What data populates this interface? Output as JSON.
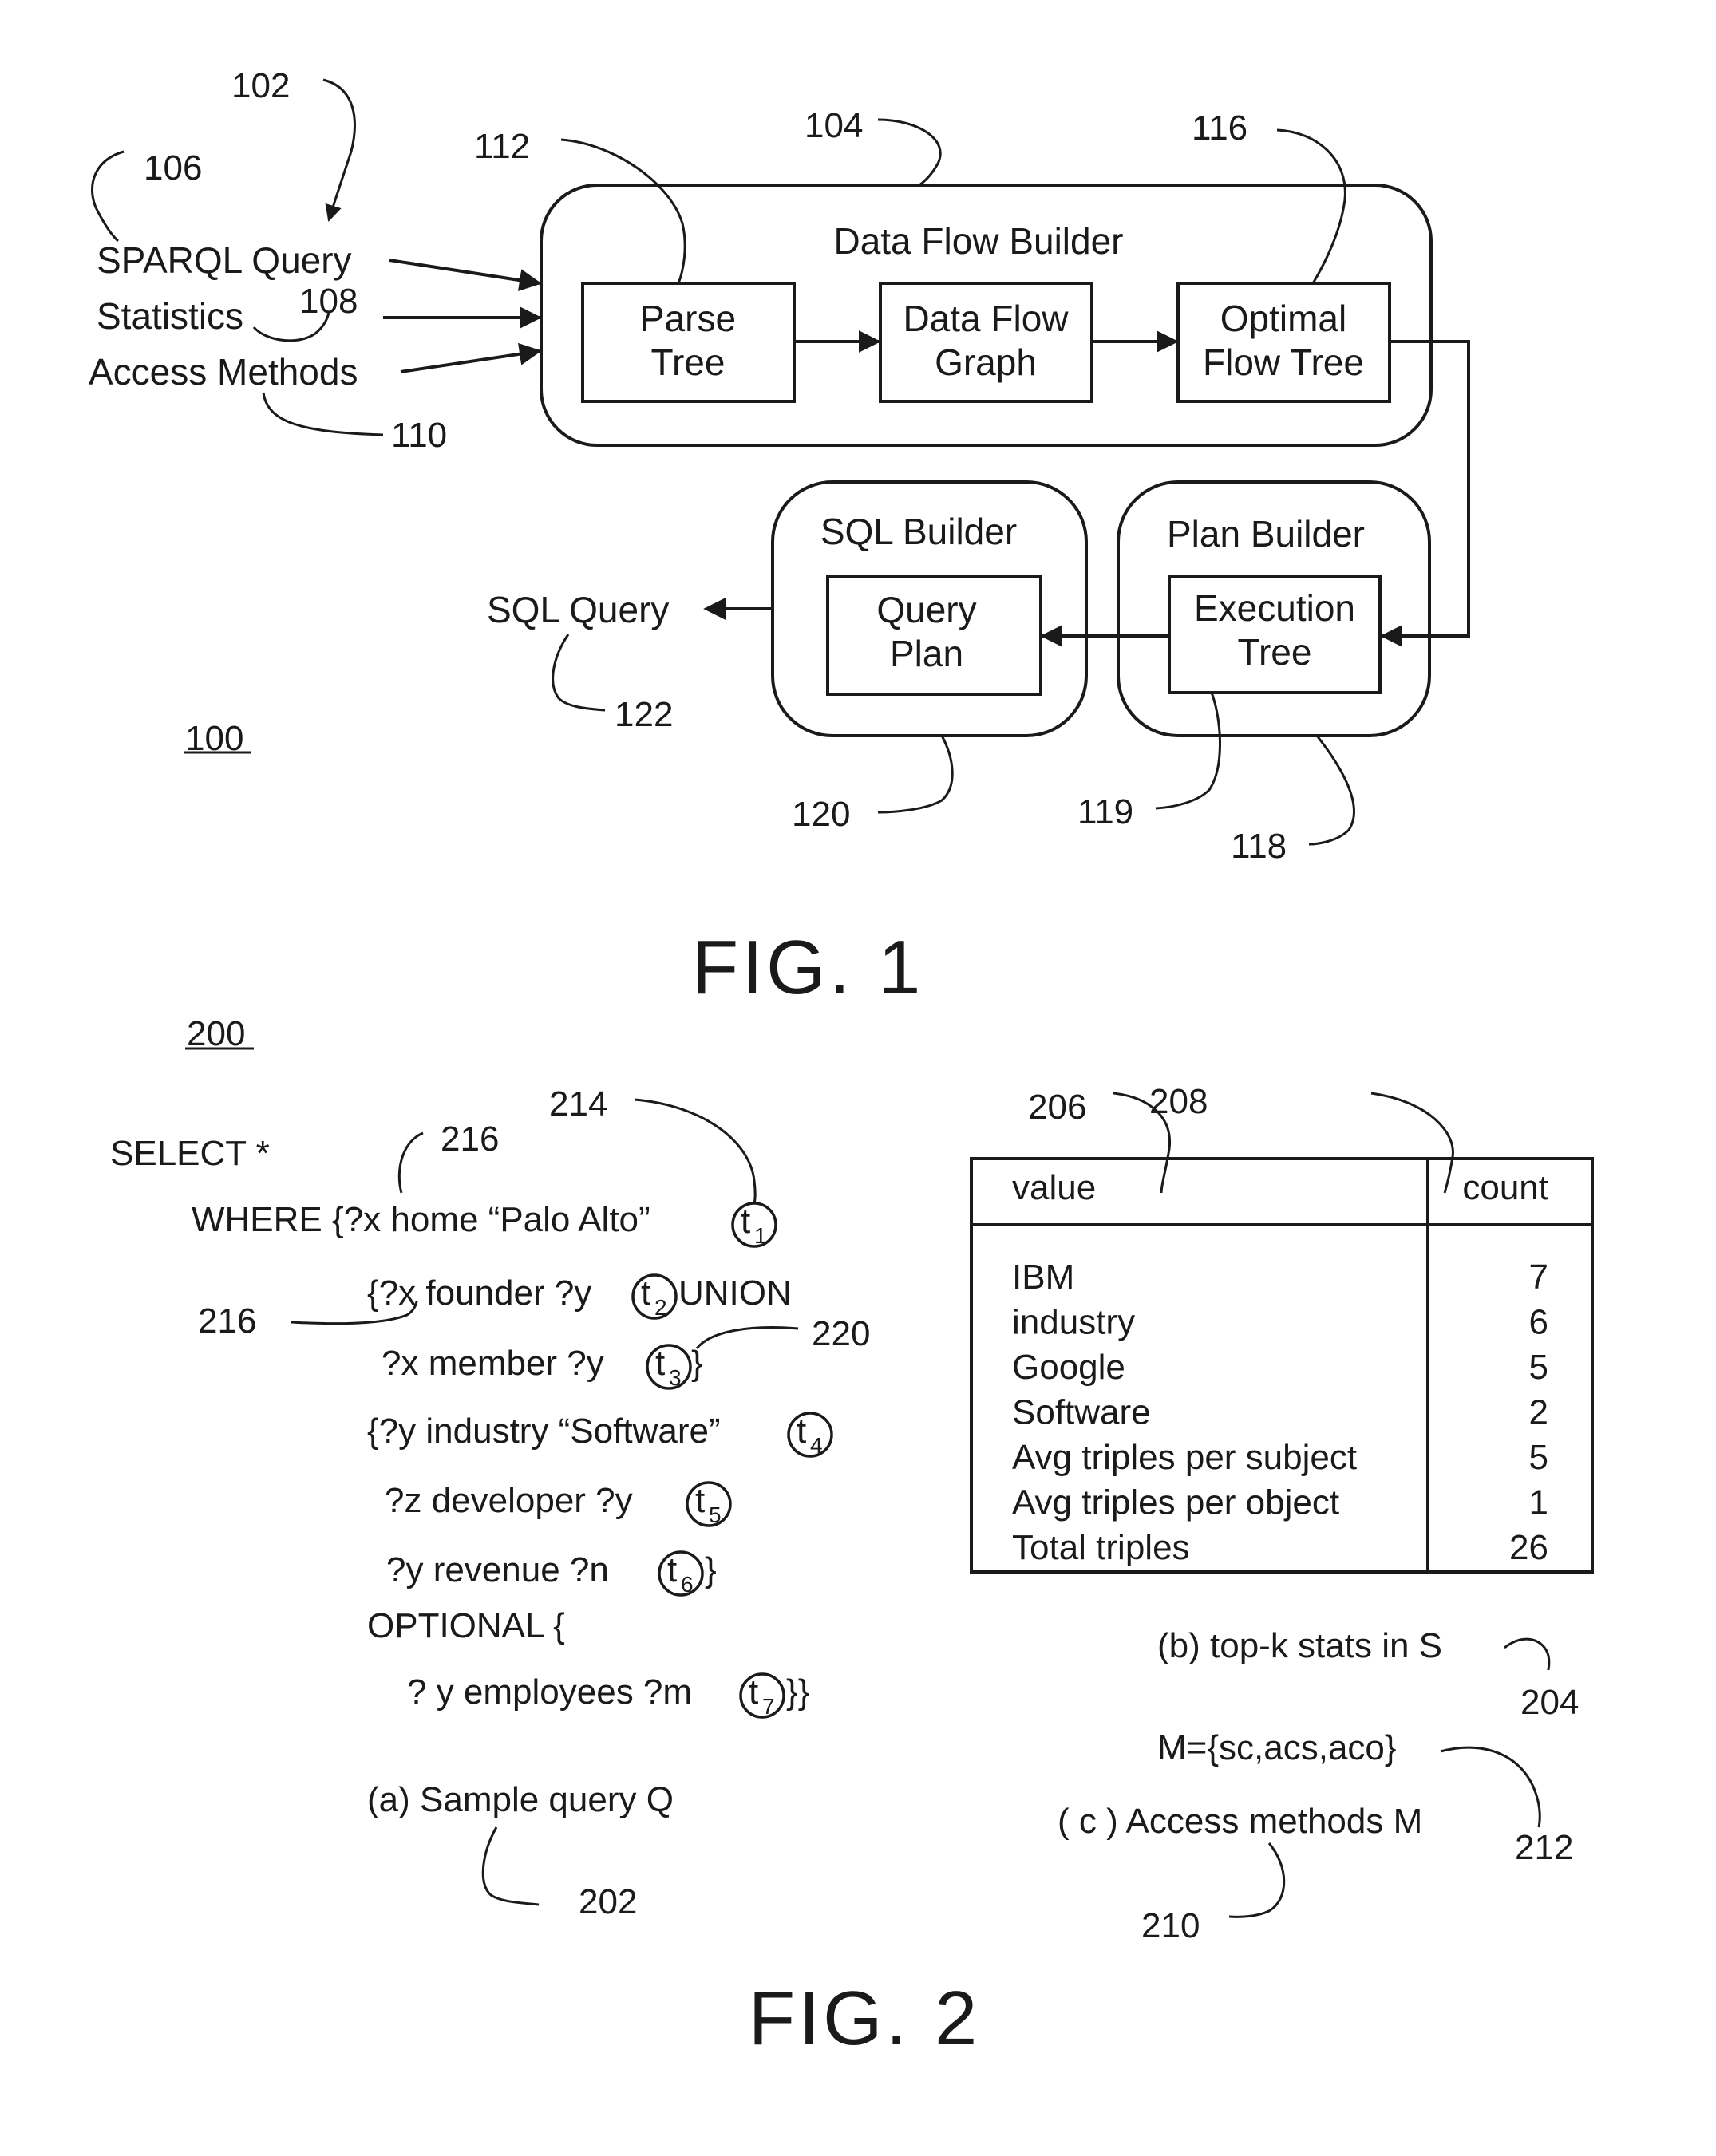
{
  "fig1": {
    "caption": "FIG. 1",
    "system_ref": "100",
    "inputs": [
      {
        "label": "SPARQL Query",
        "ref": "106"
      },
      {
        "label": "Statistics",
        "ref": "108"
      },
      {
        "label": "Access Methods",
        "ref": "110"
      }
    ],
    "input_group_ref": "102",
    "data_flow_builder": {
      "title": "Data Flow Builder",
      "ref": "104",
      "stages": [
        {
          "line1": "Parse",
          "line2": "Tree",
          "ref": "112"
        },
        {
          "line1": "Data Flow",
          "line2": "Graph",
          "ref": ""
        },
        {
          "line1": "Optimal",
          "line2": "Flow Tree",
          "ref": "116"
        }
      ]
    },
    "plan_builder": {
      "title": "Plan Builder",
      "ref": "118",
      "stage": {
        "line1": "Execution",
        "line2": "Tree",
        "ref": "119"
      }
    },
    "sql_builder": {
      "title": "SQL Builder",
      "ref": "120",
      "stage": {
        "line1": "Query",
        "line2": "Plan"
      }
    },
    "output": {
      "label": "SQL Query",
      "ref": "122"
    }
  },
  "fig2": {
    "caption": "FIG. 2",
    "system_ref": "200",
    "query": {
      "caption": "(a) Sample query Q",
      "ref": "202",
      "lines": [
        "SELECT  *",
        "WHERE {?x home “Palo Alto”",
        "{?x founder ?y",
        "UNION",
        "?x member ?y",
        "}",
        "{?y industry “Software”",
        "?z developer ?y",
        "?y revenue ?n",
        "}",
        "OPTIONAL {",
        "? y employees ?m",
        "}}"
      ],
      "triples": [
        "t",
        "t",
        "t",
        "t",
        "t",
        "t",
        "t"
      ],
      "triple_subscripts": [
        "1",
        "2",
        "3",
        "4",
        "5",
        "6",
        "7"
      ],
      "refs": {
        "triple_ref": "214",
        "variable_ref_a": "216",
        "variable_ref_b": "216",
        "union_ref": "220"
      }
    },
    "stats": {
      "caption": "(b) top-k stats in S",
      "ref": "204",
      "value_col_ref": "206",
      "count_col_ref": "208",
      "columns": [
        "value",
        "count"
      ],
      "rows": [
        {
          "value": "IBM",
          "count": "7"
        },
        {
          "value": "industry",
          "count": "6"
        },
        {
          "value": "Google",
          "count": "5"
        },
        {
          "value": "Software",
          "count": "2"
        },
        {
          "value": "Avg triples per subject",
          "count": "5"
        },
        {
          "value": "Avg triples per object",
          "count": "1"
        },
        {
          "value": "Total triples",
          "count": "26"
        }
      ]
    },
    "access_methods": {
      "set": "M={sc,acs,aco}",
      "set_ref": "212",
      "caption": "( c ) Access methods M",
      "ref": "210"
    }
  }
}
